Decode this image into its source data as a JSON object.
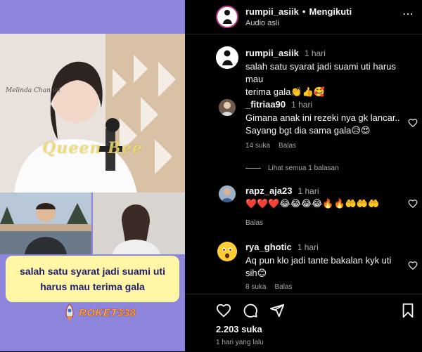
{
  "video": {
    "channel": "Melinda Channel",
    "watermark": "Queen Bee",
    "caption_line1": "salah satu syarat jadi suami uti",
    "caption_line2": "harus mau terima gala",
    "brand": "ROKET338"
  },
  "header": {
    "username": "rumpii_asiik",
    "separator": "•",
    "follow_status": "Mengikuti",
    "audio": "Audio asli"
  },
  "post": {
    "username": "rumpii_asiik",
    "time": "1 hari",
    "caption_line1": "salah satu syarat jadi suami uti harus mau",
    "caption_line2": "terima gala👏👍🥰"
  },
  "comments": [
    {
      "username": "_fitriaa90",
      "time": "1 hari",
      "line1": "Gimana anak ini rezeki nya gk lancar..",
      "line2": "Sayang bgt dia sama gala😥😍",
      "likes": "14 suka",
      "reply": "Balas",
      "view_replies": "Lihat semua 1 balasan"
    },
    {
      "username": "rapz_aja23",
      "time": "1 hari",
      "line1": "❤️❤️❤️😂😂😂😂🔥🔥🤲🤲🤲",
      "reply": "Balas"
    },
    {
      "username": "rya_ghotic",
      "time": "1 hari",
      "line1": "Aq pun klo jadi tante bakalan kyk uti",
      "line2": "sih😊",
      "likes": "8 suka",
      "reply": "Balas"
    }
  ],
  "footer": {
    "likes": "2.203 suka",
    "time": "1 hari yang lalu"
  },
  "colors": {
    "left_bg": "#8d86dc",
    "caption_bg": "#fff6a6",
    "caption_text": "#1d1d6e",
    "panel_bg": "#000000",
    "muted": "#a8a8a8"
  }
}
